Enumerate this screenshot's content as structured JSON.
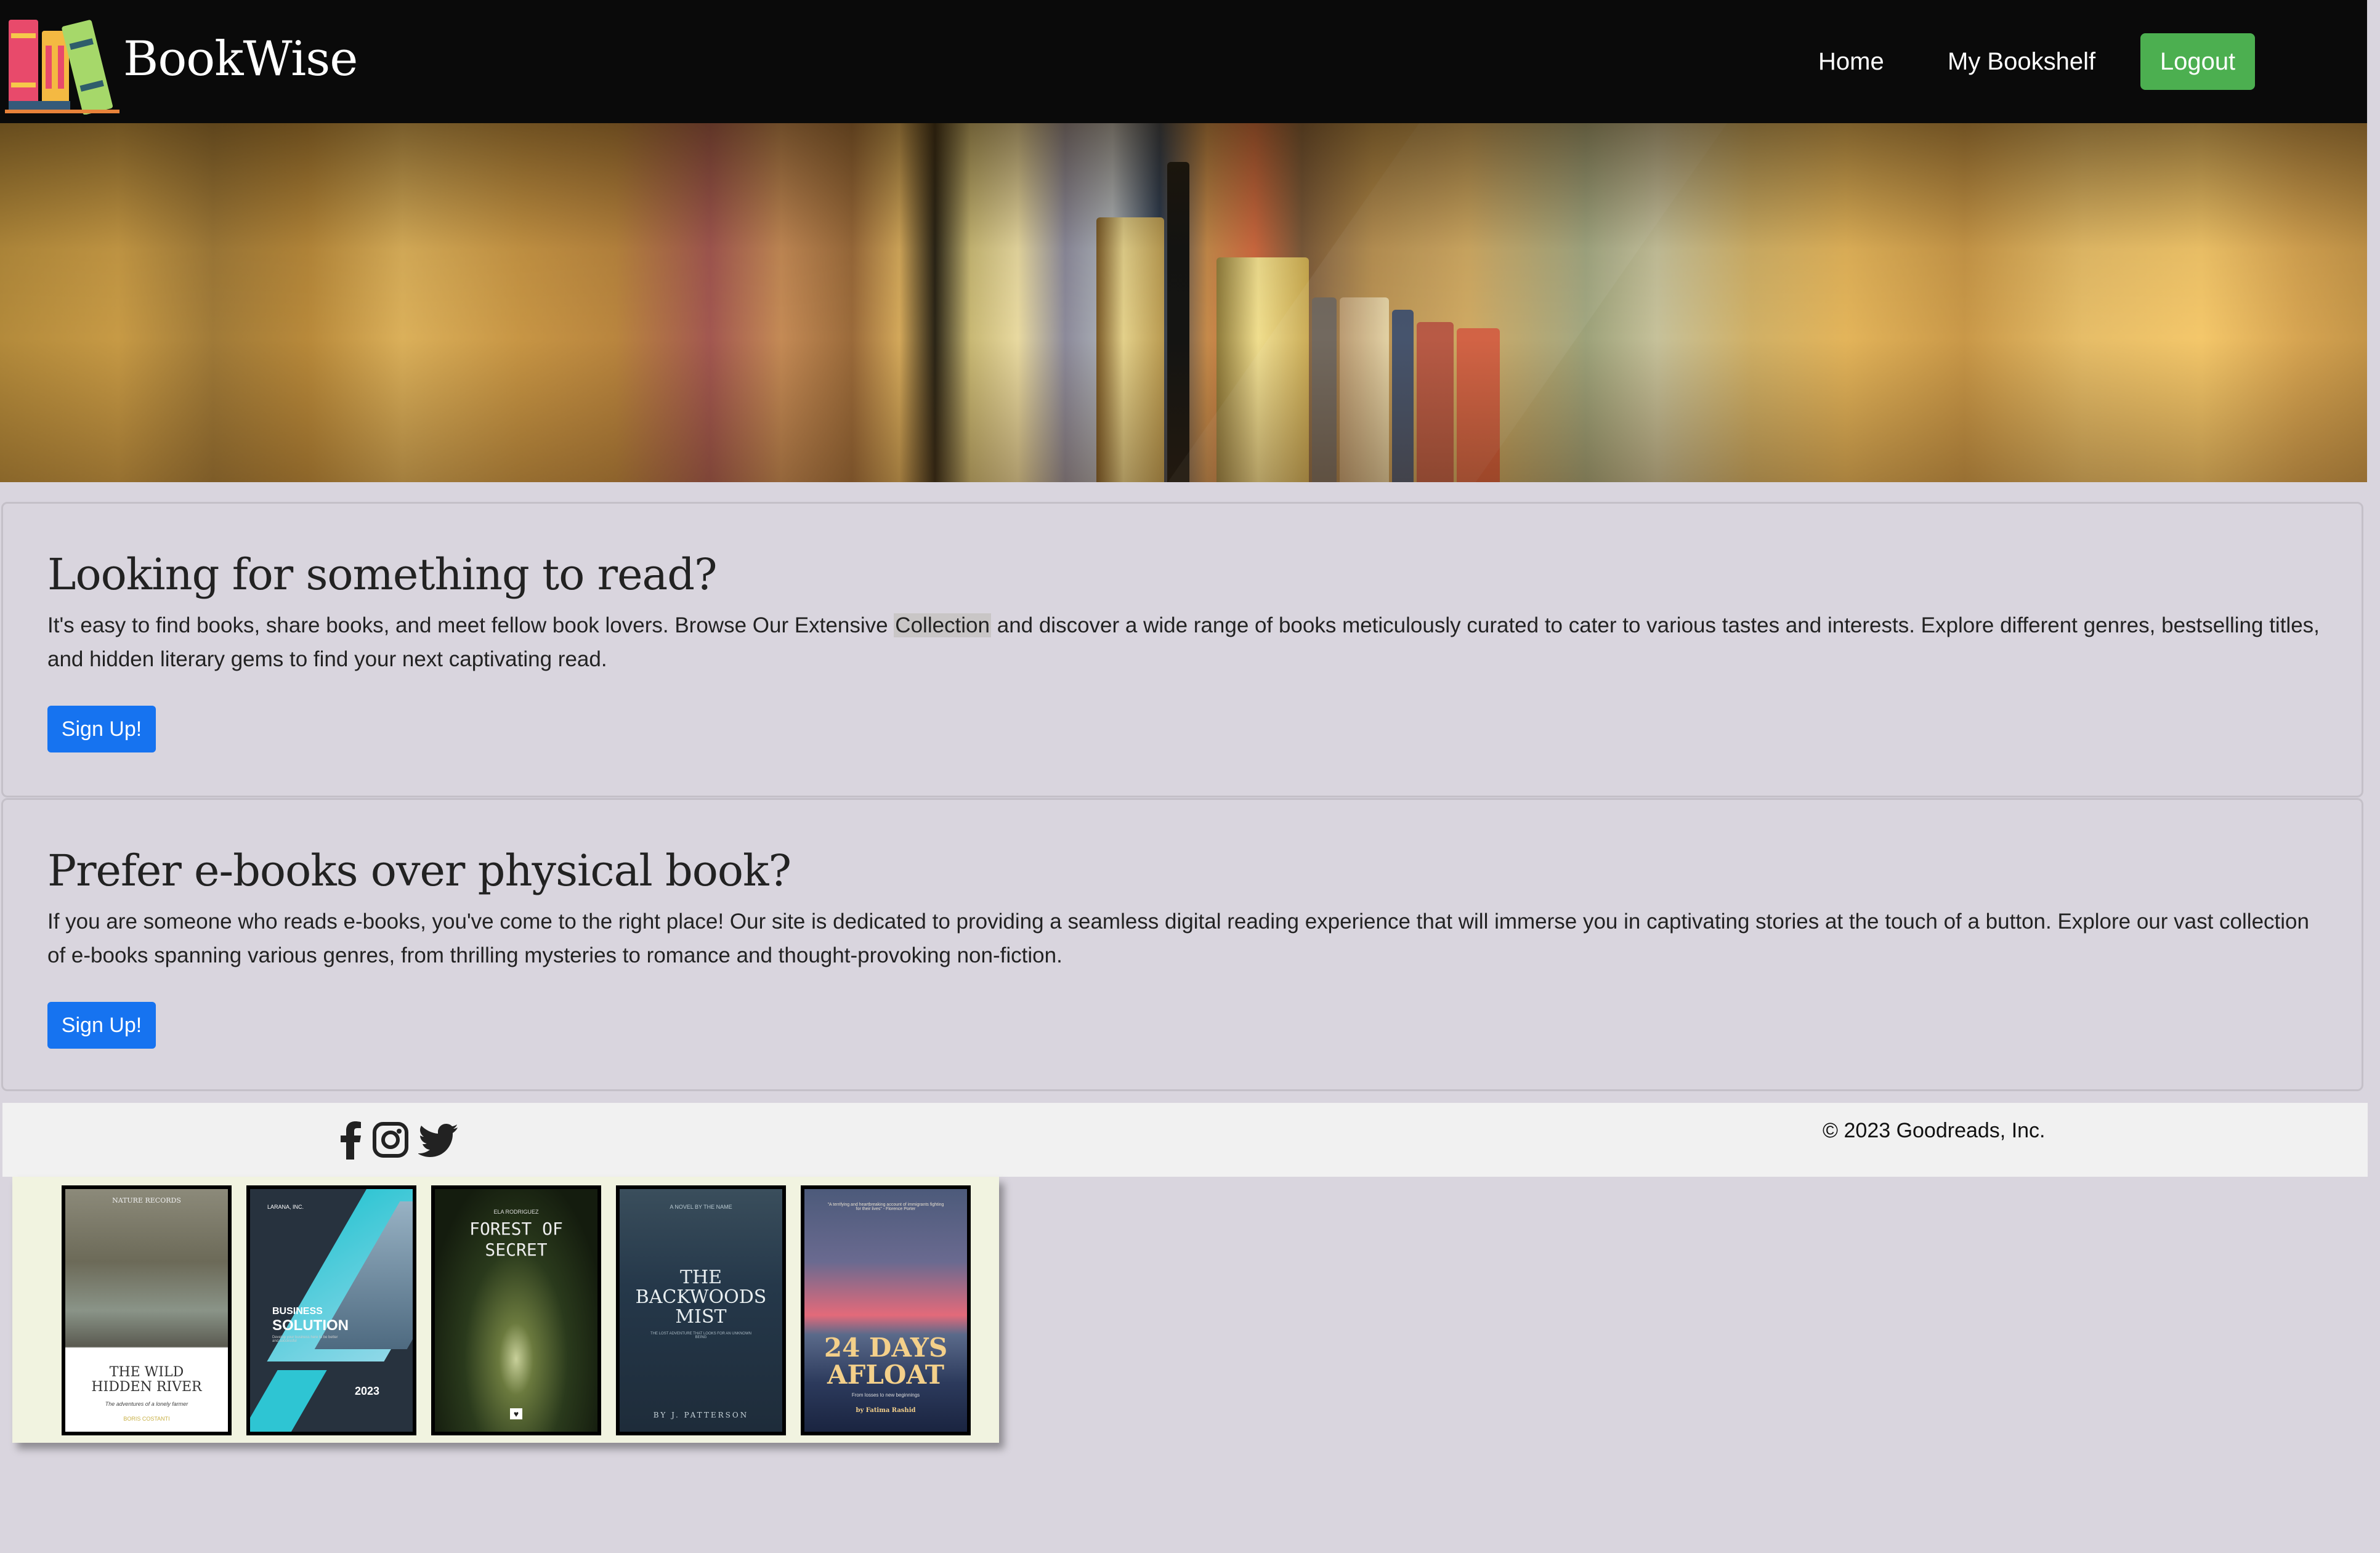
{
  "brand": {
    "name": "BookWise"
  },
  "nav": {
    "home": "Home",
    "bookshelf": "My Bookshelf",
    "logout": "Logout"
  },
  "section1": {
    "title": "Looking for something to read?",
    "text_before": "It's easy to find books, share books, and meet fellow book lovers. Browse Our Extensive ",
    "highlight": "Collection",
    "text_after": " and discover a wide range of books meticulously curated to cater to various tastes and interests. Explore different genres, bestselling titles, and hidden literary gems to find your next captivating read.",
    "button": "Sign Up!"
  },
  "section2": {
    "title": "Prefer e-books over physical book?",
    "text": "If you are someone who reads e-books, you've come to the right place! Our site is dedicated to providing a seamless digital reading experience that will immerse you in captivating stories at the touch of a button. Explore our vast collection of e-books spanning various genres, from thrilling mysteries to romance and thought-provoking non-fiction.",
    "button": "Sign Up!"
  },
  "footer": {
    "social_icons": [
      "facebook-icon",
      "instagram-icon",
      "twitter-icon"
    ],
    "copyright": "© 2023 Goodreads, Inc."
  },
  "books": [
    {
      "top": "NATURE RECORDS",
      "title": "THE WILD HIDDEN RIVER",
      "subtitle": "The adventures of a lonely farmer",
      "author": "BORIS COSTANTI"
    },
    {
      "top": "LARANA, INC.",
      "title_a": "BUSINESS",
      "title_b": "SOLUTION",
      "desc": "Develop your business here to be better and successful",
      "year": "2023"
    },
    {
      "top": "ELA RODRIGUEZ",
      "title": "FOREST OF SECRET"
    },
    {
      "top": "A NOVEL BY THE NAME",
      "title": "THE BACKWOODS MIST",
      "subtitle": "THE LOST ADVENTURE THAT LOOKS FOR AN UNKNOWN BEING",
      "author": "BY J. PATTERSON"
    },
    {
      "quote": "\"A terrifying and heartbreaking account of immigrants fighting for their lives\" - Florence Porter",
      "title_a": "24 DAYS",
      "title_b": "AFLOAT",
      "subtitle": "From losses to new beginnings",
      "author": "by Fatima Rashid"
    }
  ],
  "colors": {
    "navbar": "#0a0a0a",
    "logout": "#4caf50",
    "primary_button": "#1673f0",
    "page_bg": "#d9d5de"
  }
}
